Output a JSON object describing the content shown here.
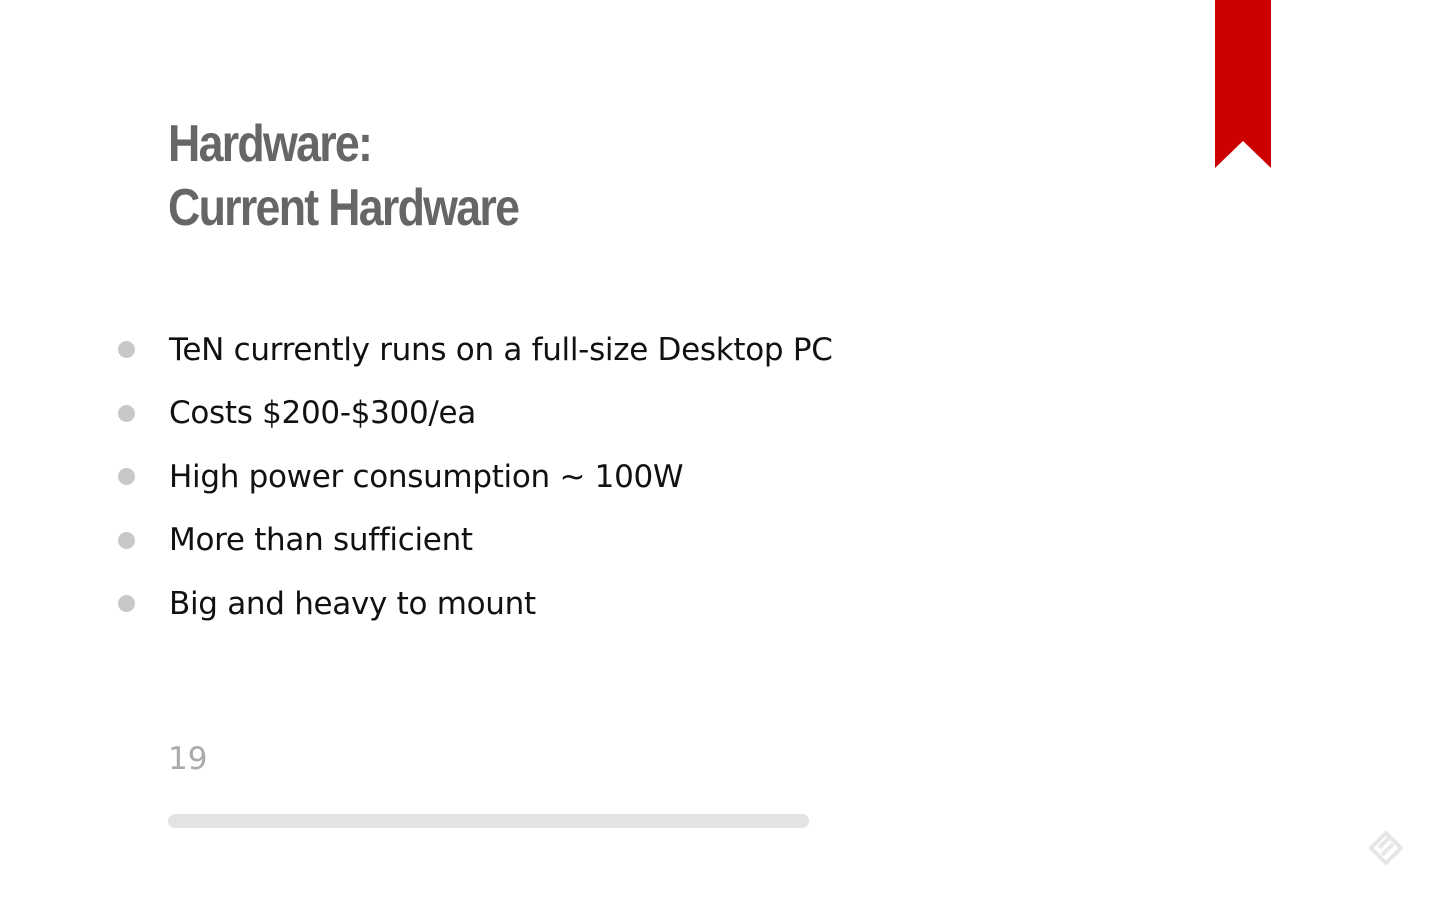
{
  "slide": {
    "title_line1": "Hardware:",
    "title_line2": "Current Hardware",
    "bullets": [
      "TeN currently runs on a full-size Desktop PC",
      "Costs $200-$300/ea",
      "High power consumption ~ 100W",
      "More than sufficient",
      "Big and heavy to mount"
    ],
    "page_number": "19",
    "progress_fraction": 1.0
  },
  "icons": {
    "bookmark": "bookmark-ribbon-icon",
    "logo": "presentation-app-logo-icon"
  },
  "colors": {
    "accent": "#cc0000",
    "title": "#666666",
    "bullet_dot": "#c8c8c8",
    "body_text": "#111111",
    "page_number": "#aaaaaa",
    "progress": "#e3e3e3",
    "logo": "#e6e6e6"
  }
}
